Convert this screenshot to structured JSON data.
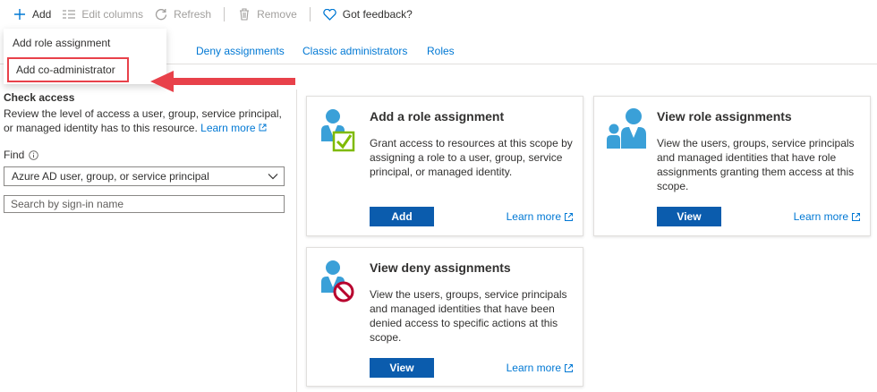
{
  "toolbar": {
    "add_label": "Add",
    "edit_columns_label": "Edit columns",
    "refresh_label": "Refresh",
    "remove_label": "Remove",
    "feedback_label": "Got feedback?"
  },
  "menu": {
    "items": [
      {
        "label": "Add role assignment"
      },
      {
        "label": "Add co-administrator"
      }
    ]
  },
  "tabs": [
    {
      "label": "Deny assignments"
    },
    {
      "label": "Classic administrators"
    },
    {
      "label": "Roles"
    }
  ],
  "check_access": {
    "title": "Check access",
    "description": "Review the level of access a user, group, service principal, or managed identity has to this resource.",
    "learn_more": "Learn more",
    "find_label": "Find",
    "select_value": "Azure AD user, group, or service principal",
    "search_placeholder": "Search by sign-in name"
  },
  "cards": [
    {
      "title": "Add a role assignment",
      "description": "Grant access to resources at this scope by assigning a role to a user, group, service principal, or managed identity.",
      "button": "Add",
      "learn_more": "Learn more"
    },
    {
      "title": "View role assignments",
      "description": "View the users, groups, service principals and managed identities that have role assignments granting them access at this scope.",
      "button": "View",
      "learn_more": "Learn more"
    },
    {
      "title": "View deny assignments",
      "description": "View the users, groups, service principals and managed identities that have been denied access to specific actions at this scope.",
      "button": "View",
      "learn_more": "Learn more"
    }
  ],
  "colors": {
    "link": "#0078d4",
    "primary_button": "#0b5cad",
    "highlight_red": "#e8414a",
    "icon_blue": "#3aa0d8",
    "check_green": "#7fba00",
    "deny_red": "#b8002e"
  }
}
